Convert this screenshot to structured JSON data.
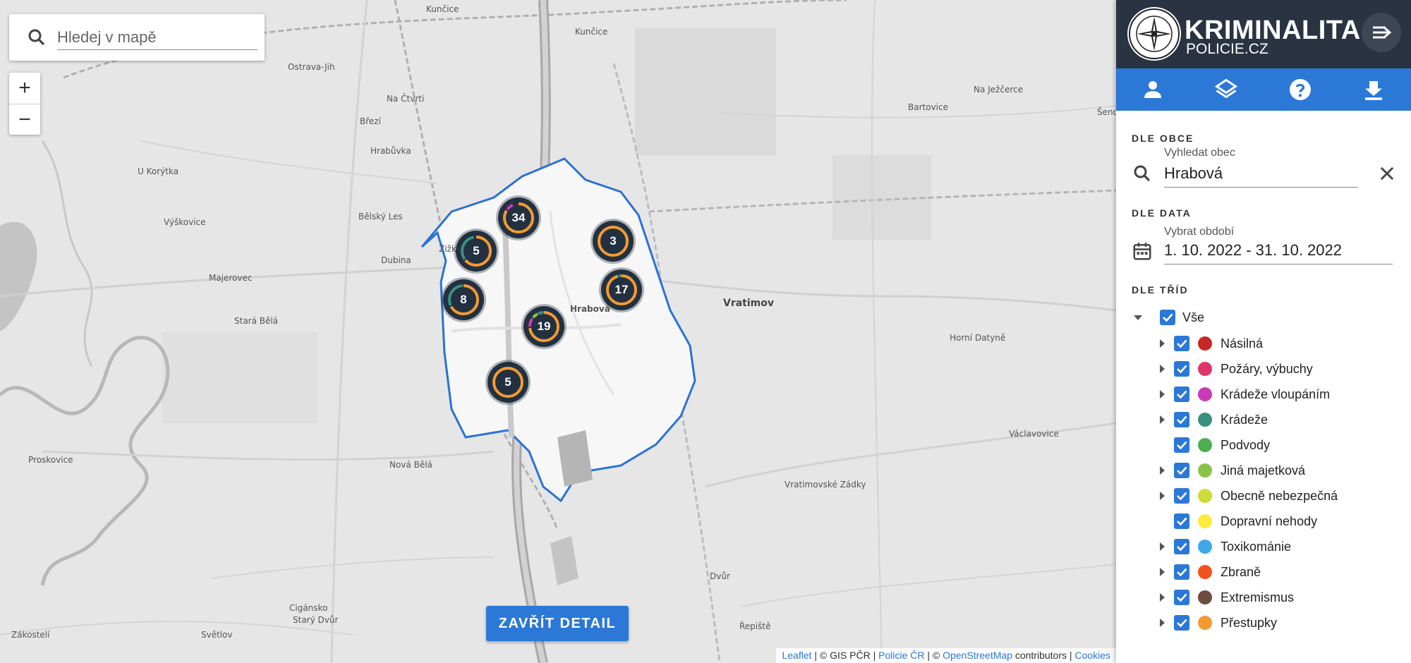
{
  "map": {
    "search": {
      "placeholder": "Hledej v mapě"
    },
    "zoom": {
      "in": "+",
      "out": "−"
    },
    "places": [
      "Kunčice",
      "Ostrava-Jih",
      "Na Čtvrti",
      "Březí",
      "Hrabůvka",
      "U Korýtka",
      "Výškovice",
      "Bělský Les",
      "Dubina",
      "Majerovec",
      "Stará Bělá",
      "Žižkov",
      "Nová Bělá",
      "Proskovice",
      "Hrabová",
      "Vratimov",
      "Bartovice",
      "Na Ježčerce",
      "Horní Datyně",
      "Václavovice",
      "Vratimovské Zádky",
      "Řepiště",
      "Dvůr",
      "Cigánsko",
      "Starý Dvůr",
      "Světlov",
      "Zákostelí",
      "Šenov"
    ],
    "clusters": [
      "34",
      "5",
      "3",
      "8",
      "17",
      "19",
      "5"
    ],
    "close_button": "ZAVŘÍT DETAIL",
    "attribution": {
      "leaflet": "Leaflet",
      "sep1": " | © GIS PČR | ",
      "policie": "Policie ČR",
      "sep2": " | © ",
      "osm": "OpenStreetMap",
      "contributors": " contributors | ",
      "cookies": "Cookies"
    }
  },
  "panel": {
    "brand_title": "KRIMINALITA",
    "brand_sub": "POLICIE.CZ",
    "toolbar_icons": [
      "person-icon",
      "layers-icon",
      "help-icon",
      "download-icon"
    ],
    "section_obec": {
      "title": "DLE OBCE",
      "label": "Vyhledat obec",
      "value": "Hrabová"
    },
    "section_data": {
      "title": "DLE DATA",
      "label": "Vybrat období",
      "value": "1. 10. 2022 - 31. 10. 2022"
    },
    "section_tridy": {
      "title": "DLE TŘÍD",
      "all_label": "Vše",
      "categories": [
        {
          "label": "Násilná",
          "color": "#c62828",
          "expandable": true
        },
        {
          "label": "Požáry, výbuchy",
          "color": "#e0356b",
          "expandable": true
        },
        {
          "label": "Krádeže vloupáním",
          "color": "#c93bb3",
          "expandable": true
        },
        {
          "label": "Krádeže",
          "color": "#3a9080",
          "expandable": true
        },
        {
          "label": "Podvody",
          "color": "#4caf50",
          "expandable": false
        },
        {
          "label": "Jiná majetková",
          "color": "#8bc34a",
          "expandable": true
        },
        {
          "label": "Obecně nebezpečná",
          "color": "#cddc39",
          "expandable": true
        },
        {
          "label": "Dopravní nehody",
          "color": "#ffeb3b",
          "expandable": false
        },
        {
          "label": "Toxikománie",
          "color": "#3ea8e8",
          "expandable": true
        },
        {
          "label": "Zbraně",
          "color": "#f4511e",
          "expandable": true
        },
        {
          "label": "Extremismus",
          "color": "#6d4c41",
          "expandable": true
        },
        {
          "label": "Přestupky",
          "color": "#f39a33",
          "expandable": true
        }
      ]
    }
  }
}
